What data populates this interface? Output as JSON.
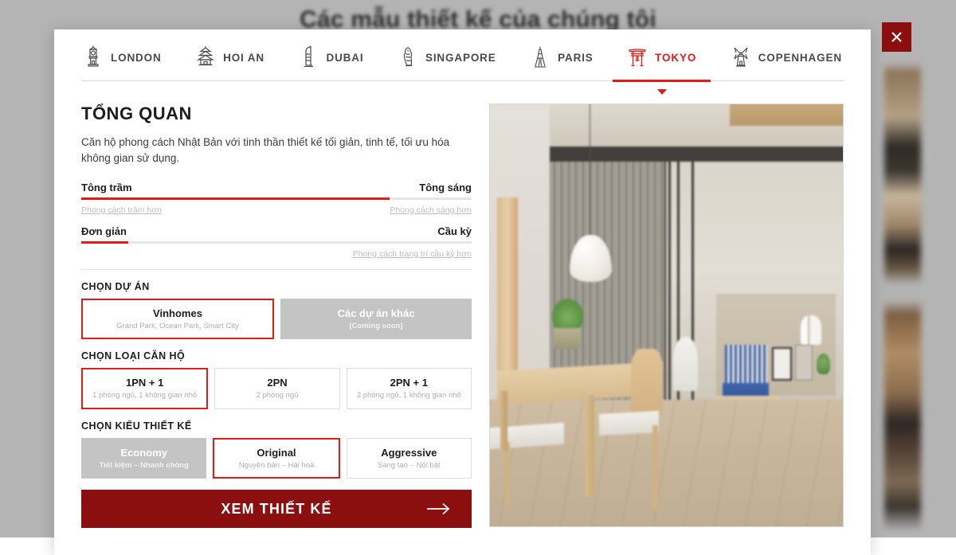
{
  "background": {
    "page_title": "Các mẫu thiết kế của chúng tôi"
  },
  "close_button": {
    "label": "×",
    "icon": "close-icon",
    "color": "#8c0f0f"
  },
  "tabs": [
    {
      "label": "LONDON",
      "icon": "big-ben-icon",
      "active": false
    },
    {
      "label": "HOI AN",
      "icon": "pagoda-icon",
      "active": false
    },
    {
      "label": "DUBAI",
      "icon": "burj-al-arab-icon",
      "active": false
    },
    {
      "label": "SINGAPORE",
      "icon": "merlion-icon",
      "active": false
    },
    {
      "label": "PARIS",
      "icon": "eiffel-tower-icon",
      "active": false
    },
    {
      "label": "TOKYO",
      "icon": "torii-gate-icon",
      "active": true
    },
    {
      "label": "COPENHAGEN",
      "icon": "windmill-icon",
      "active": false
    }
  ],
  "overview": {
    "title": "TỔNG QUAN",
    "description": "Căn hộ phong cách Nhật Bản với tinh thần thiết kế tối giản, tinh tế, tối ưu hóa không gian sử dụng."
  },
  "sliders": [
    {
      "left_label": "Tông trầm",
      "right_label": "Tông sáng",
      "left_hint": "Phong cách trầm hơn",
      "right_hint": "Phong cách sáng hơn",
      "value_percent": 79
    },
    {
      "left_label": "Đơn giản",
      "right_label": "Cầu kỳ",
      "left_hint": "",
      "right_hint": "Phong cách trang trí cầu kỳ hơn",
      "value_percent": 12
    }
  ],
  "project_section": {
    "title": "CHỌN DỰ ÁN",
    "options": [
      {
        "title": "Vinhomes",
        "subtitle": "Grand Park, Ocean Park, Smart City",
        "state": "selected"
      },
      {
        "title": "Các dự án khác",
        "subtitle": "[Coming soon]",
        "state": "disabled"
      }
    ]
  },
  "apartment_section": {
    "title": "CHỌN LOẠI CĂN HỘ",
    "options": [
      {
        "title": "1PN + 1",
        "subtitle": "1 phòng ngủ, 1 không gian nhỏ",
        "state": "selected"
      },
      {
        "title": "2PN",
        "subtitle": "2 phòng ngủ",
        "state": "default"
      },
      {
        "title": "2PN + 1",
        "subtitle": "2 phòng ngủ, 1 không gian nhỏ",
        "state": "default"
      }
    ]
  },
  "design_section": {
    "title": "CHỌN KIỂU THIẾT KẾ",
    "options": [
      {
        "title": "Economy",
        "subtitle": "Tiết kiệm – Nhanh chóng",
        "state": "disabled"
      },
      {
        "title": "Original",
        "subtitle": "Nguyên bản – Hài hoà",
        "state": "selected"
      },
      {
        "title": "Aggressive",
        "subtitle": "Sáng tạo – Nổi bật",
        "state": "default"
      }
    ]
  },
  "cta": {
    "label": "XEM THIẾT KẾ",
    "icon": "arrow-right-icon",
    "color": "#8c0f0f"
  },
  "preview_image": {
    "alt": "Phối cảnh căn hộ phong cách Nhật Bản"
  },
  "colors": {
    "accent_red": "#e31b16",
    "deep_red": "#8c0f0f",
    "disabled_gray": "#c4c4c4",
    "border_gray": "#dcdcdc"
  }
}
